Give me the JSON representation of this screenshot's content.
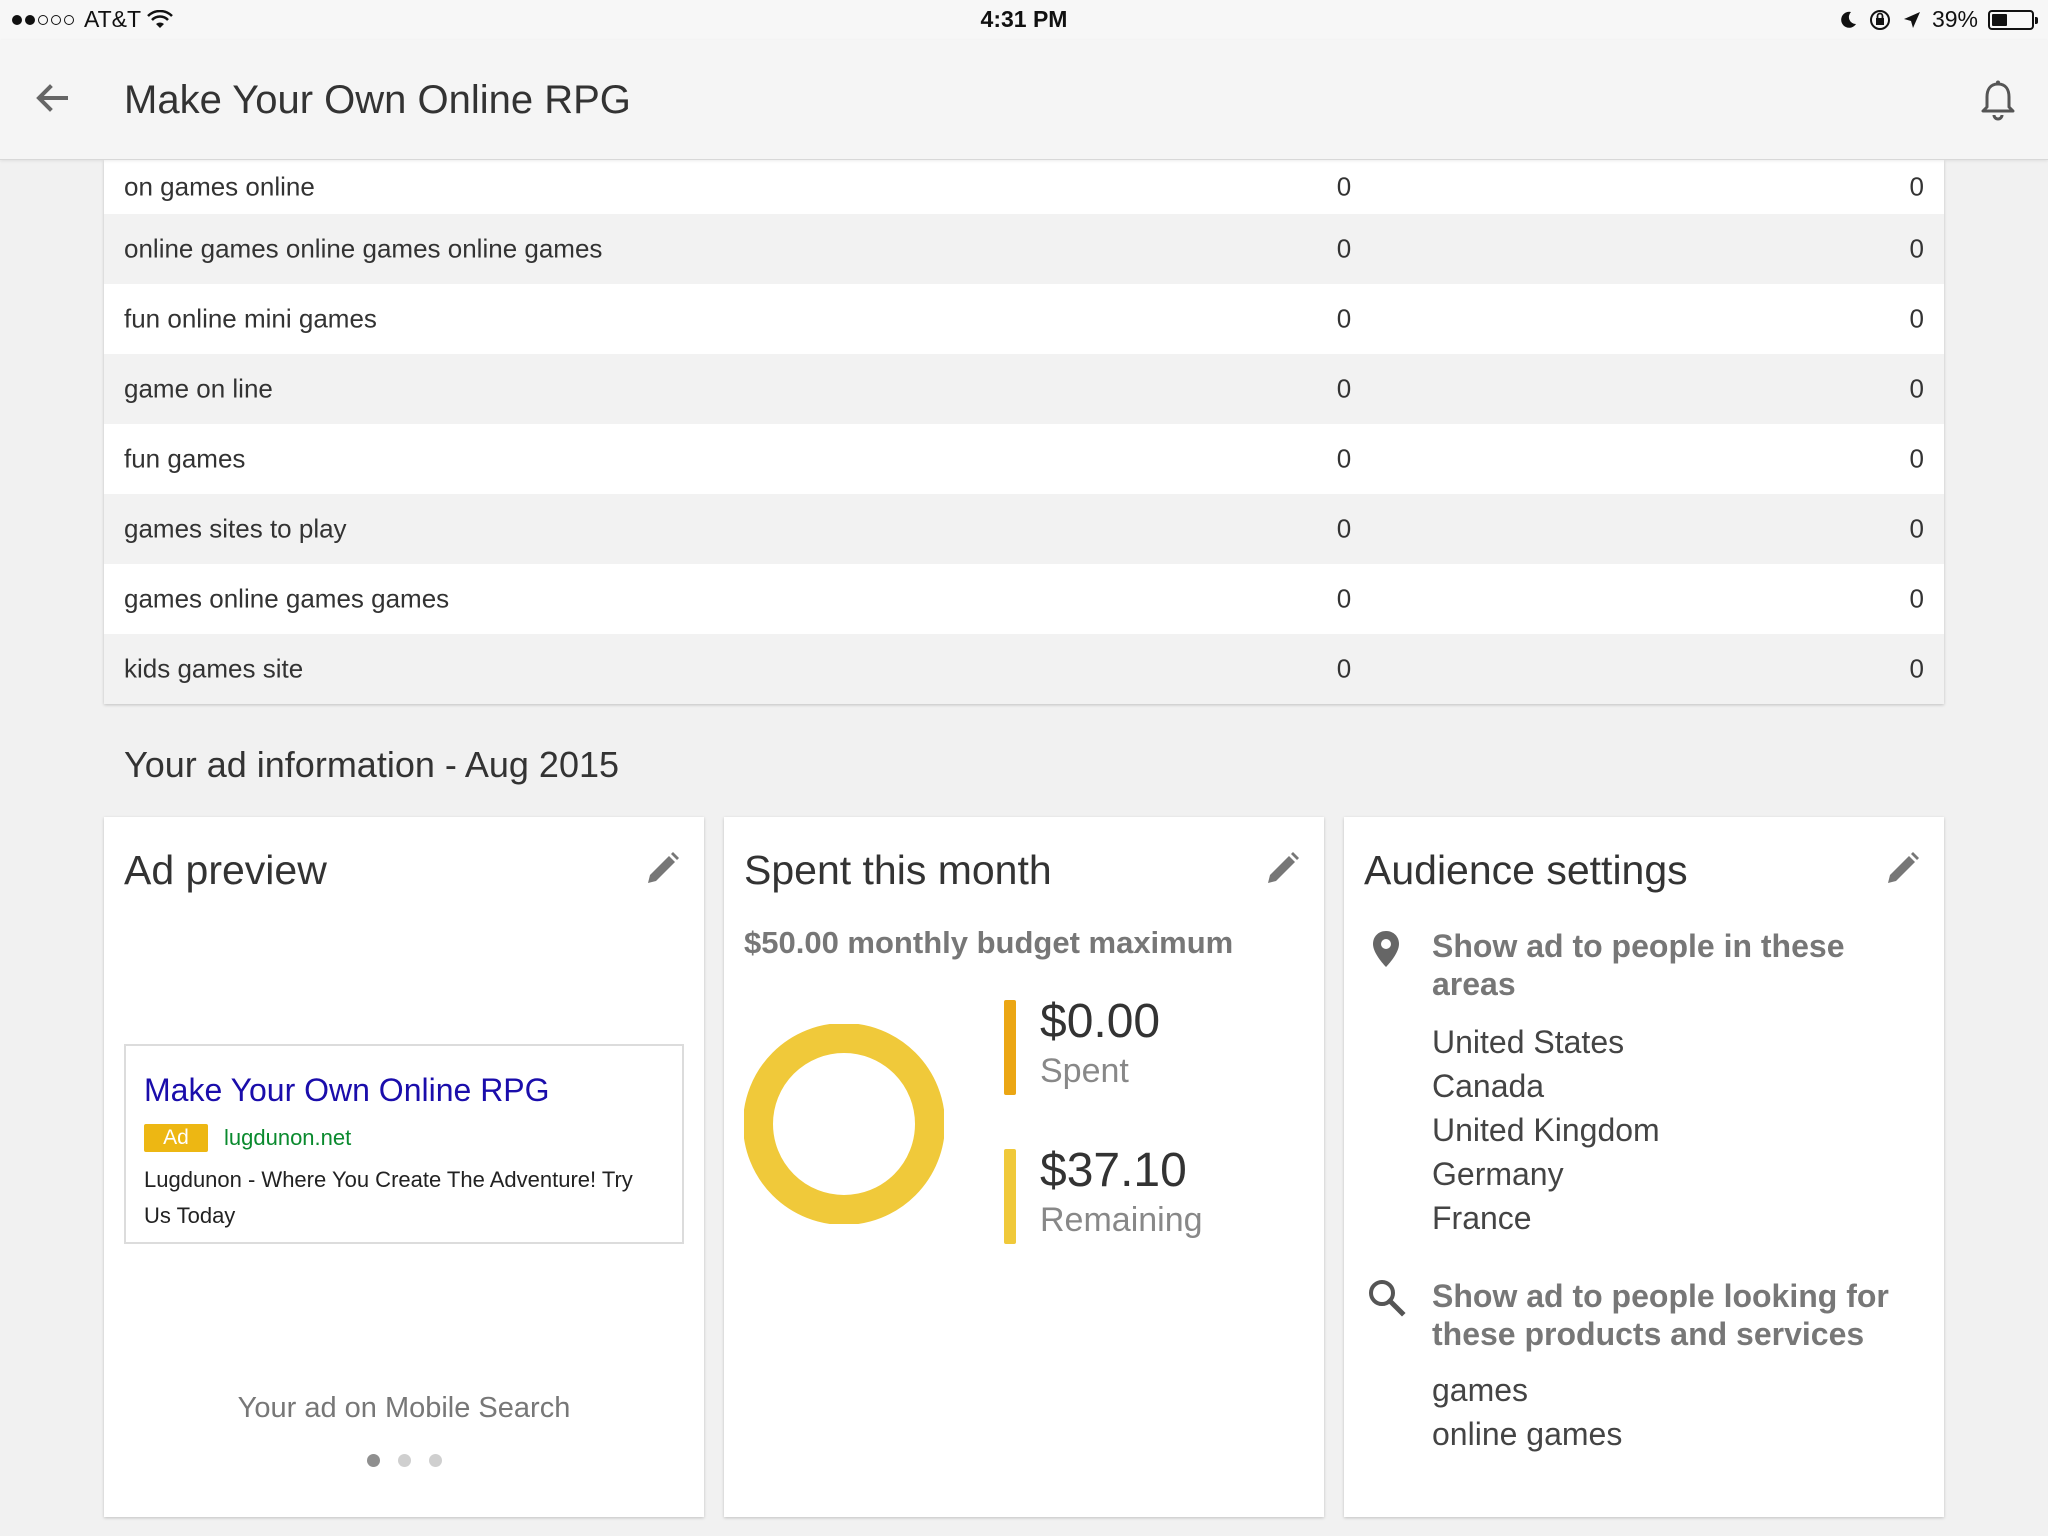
{
  "status_bar": {
    "carrier": "AT&T",
    "time": "4:31 PM",
    "battery_percent": "39%",
    "battery_level": 0.39
  },
  "header": {
    "title": "Make Your Own Online RPG"
  },
  "keywords_table": {
    "rows": [
      {
        "keyword": "on games online",
        "v1": "0",
        "v2": "0"
      },
      {
        "keyword": "online games online games online games",
        "v1": "0",
        "v2": "0"
      },
      {
        "keyword": "fun online mini games",
        "v1": "0",
        "v2": "0"
      },
      {
        "keyword": "game on line",
        "v1": "0",
        "v2": "0"
      },
      {
        "keyword": "fun games",
        "v1": "0",
        "v2": "0"
      },
      {
        "keyword": "games sites to play",
        "v1": "0",
        "v2": "0"
      },
      {
        "keyword": "games online games games",
        "v1": "0",
        "v2": "0"
      },
      {
        "keyword": "kids games site",
        "v1": "0",
        "v2": "0"
      }
    ]
  },
  "section": {
    "title": "Your ad information - Aug 2015"
  },
  "ad_preview": {
    "title": "Ad preview",
    "headline": "Make Your Own Online RPG",
    "badge": "Ad",
    "url": "lugdunon.net",
    "description": "Lugdunon - Where You Create The Adventure! Try Us Today",
    "caption": "Your ad on Mobile Search",
    "carousel_active_index": 0,
    "carousel_count": 3
  },
  "spent": {
    "title": "Spent this month",
    "budget": "$50.00 monthly budget maximum",
    "spent_value": "$0.00",
    "spent_label": "Spent",
    "remaining_value": "$37.10",
    "remaining_label": "Remaining",
    "spent_amount": 0.0,
    "remaining_amount": 37.1,
    "colors": {
      "spent": "#eba614",
      "remaining": "#f0c93a"
    }
  },
  "audience": {
    "title": "Audience settings",
    "areas_heading": "Show ad to people in these areas",
    "areas": [
      "United States",
      "Canada",
      "United Kingdom",
      "Germany",
      "France"
    ],
    "search_heading": "Show ad to people looking for these products and services",
    "search_terms": [
      "games",
      "online games"
    ]
  },
  "icons": {
    "back": "arrow-left-icon",
    "notifications": "bell-icon",
    "edit": "pencil-icon",
    "location": "map-pin-icon",
    "search": "search-icon"
  }
}
